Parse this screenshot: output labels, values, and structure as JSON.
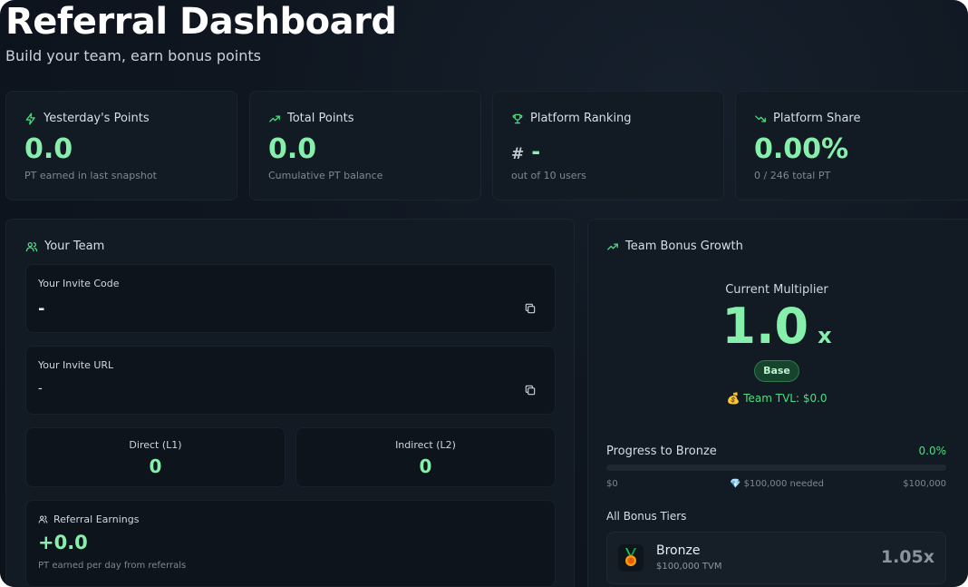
{
  "header": {
    "title": "Referral Dashboard",
    "subtitle": "Build your team, earn bonus points"
  },
  "stats": [
    {
      "icon": "lightning-icon",
      "label": "Yesterday's Points",
      "value": "0.0",
      "sub": "PT earned in last snapshot"
    },
    {
      "icon": "trending-up-icon",
      "label": "Total Points",
      "value": "0.0",
      "sub": "Cumulative PT balance"
    },
    {
      "icon": "trophy-icon",
      "label": "Platform Ranking",
      "prefix": "#",
      "value": "-",
      "sub": "out of 10 users"
    },
    {
      "icon": "trending-down-icon",
      "label": "Platform Share",
      "value": "0.00%",
      "sub": "0 / 246 total PT"
    }
  ],
  "team": {
    "title": "Your Team",
    "invite_code": {
      "label": "Your Invite Code",
      "value": "-"
    },
    "invite_url": {
      "label": "Your Invite URL",
      "value": "-"
    },
    "direct": {
      "label": "Direct (L1)",
      "value": "0"
    },
    "indirect": {
      "label": "Indirect (L2)",
      "value": "0"
    },
    "earnings": {
      "label": "Referral Earnings",
      "value": "+0.0",
      "sub": "PT earned per day from referrals"
    }
  },
  "bonus": {
    "title": "Team Bonus Growth",
    "multiplier_label": "Current Multiplier",
    "multiplier": "1.0",
    "multiplier_suffix": "x",
    "tier_badge": "Base",
    "tvl": "💰 Team TVL: $0.0",
    "progress_label": "Progress to Bronze",
    "progress_pct": "0.0%",
    "progress_fraction": 0.0,
    "progress_min": "$0",
    "progress_needed": "💎 $100,000 needed",
    "progress_max": "$100,000",
    "tiers_label": "All Bonus Tiers",
    "tiers": [
      {
        "icon": "medal-icon",
        "name": "Bronze",
        "requirement": "$100,000 TVM",
        "multiplier": "1.05x"
      }
    ]
  },
  "colors": {
    "accent": "#86efac",
    "accent_strong": "#4ade80",
    "background": "#0f1620",
    "card": "#121a23"
  }
}
